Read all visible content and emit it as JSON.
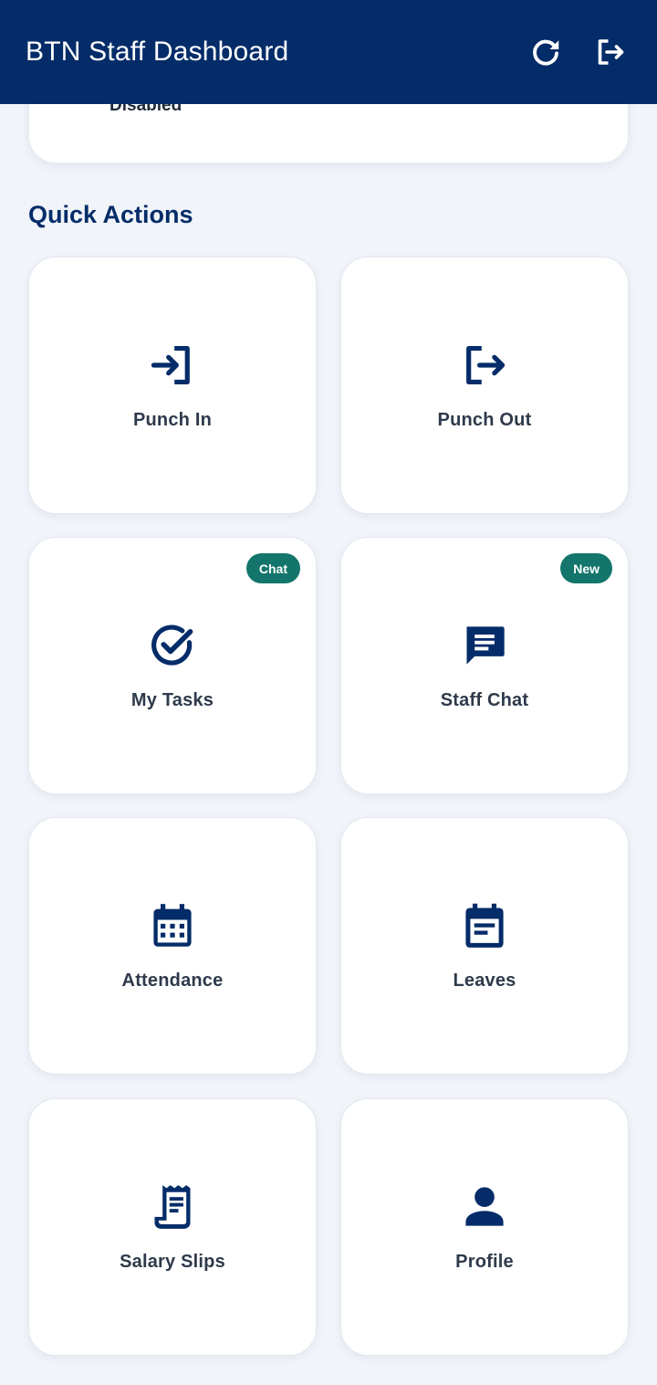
{
  "appbar": {
    "title": "BTN Staff Dashboard",
    "refresh_icon": "refresh-icon",
    "logout_icon": "logout-icon"
  },
  "status_card": {
    "text": "Disabled"
  },
  "quick_actions": {
    "title": "Quick Actions",
    "tiles": [
      {
        "label": "Punch In",
        "icon": "login-icon",
        "badge": ""
      },
      {
        "label": "Punch Out",
        "icon": "logout-icon",
        "badge": ""
      },
      {
        "label": "My Tasks",
        "icon": "check-circle-icon",
        "badge": "Chat"
      },
      {
        "label": "Staff Chat",
        "icon": "chat-icon",
        "badge": "New"
      },
      {
        "label": "Attendance",
        "icon": "calendar-icon",
        "badge": ""
      },
      {
        "label": "Leaves",
        "icon": "event-note-icon",
        "badge": ""
      },
      {
        "label": "Salary Slips",
        "icon": "receipt-icon",
        "badge": ""
      },
      {
        "label": "Profile",
        "icon": "person-icon",
        "badge": ""
      }
    ]
  },
  "colors": {
    "primary": "#042c69",
    "badge": "#13756b",
    "background": "#f1f4f9",
    "tile_text": "#2e3a4b"
  }
}
